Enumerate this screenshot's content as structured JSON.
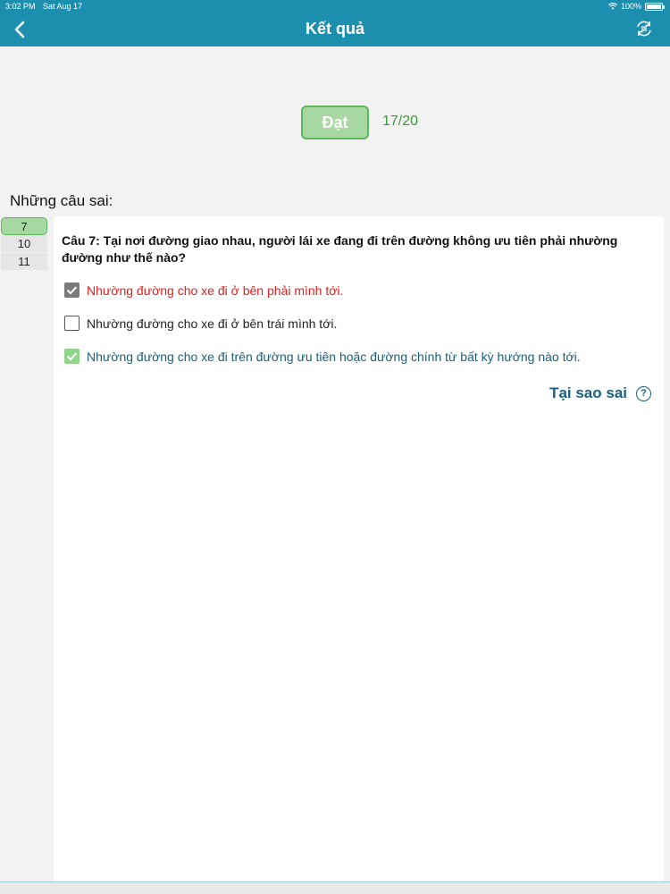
{
  "status": {
    "time": "3:02 PM",
    "date": "Sat Aug 17",
    "battery": "100%"
  },
  "nav": {
    "title": "Kết quả",
    "back_icon": "chevron-left-icon",
    "refresh_icon": "refresh-icon"
  },
  "result": {
    "badge_label": "Đạt",
    "score": "17/20"
  },
  "section_title": "Những câu sai:",
  "wrong_items": [
    {
      "label": "7"
    },
    {
      "label": "10"
    },
    {
      "label": "11"
    }
  ],
  "question": {
    "text": "Câu 7: Tại nơi đường giao nhau, người lái xe đang đi trên đường không ưu tiên phải nhường đường như thế nào?",
    "answers": [
      {
        "text": "Nhường đường cho xe đi ở bên phải mình tới."
      },
      {
        "text": "Nhường đường cho xe đi ở bên trái mình tới."
      },
      {
        "text": "Nhường đường cho xe đi trên đường ưu tiên hoặc đường chính từ bất kỳ hướng nào tới."
      }
    ]
  },
  "why_link": "Tại sao sai",
  "colors": {
    "header": "#1d8fae",
    "pass_fill": "#a8d8a2",
    "wrong": "#e01e1e",
    "correct": "#1a5f7e"
  }
}
